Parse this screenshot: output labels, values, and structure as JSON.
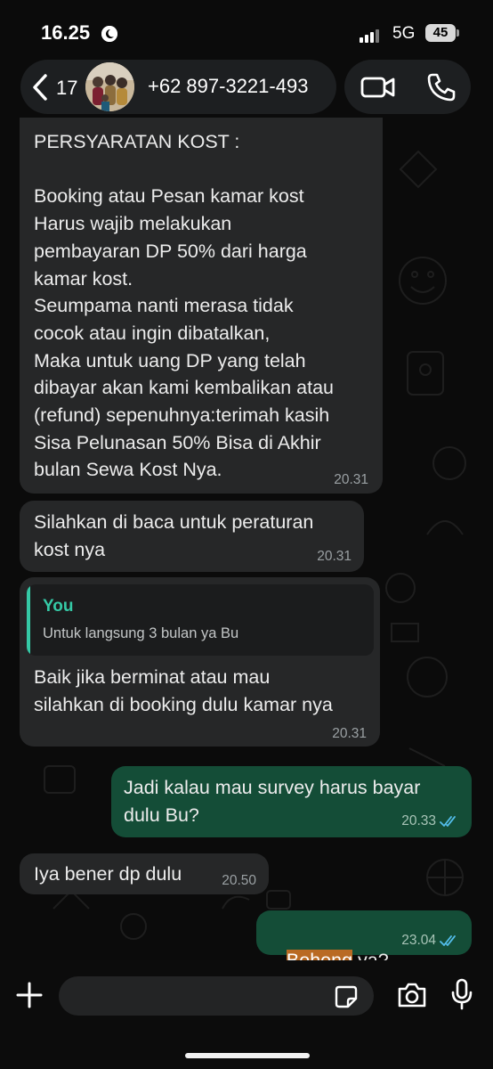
{
  "status_bar": {
    "time": "16.25",
    "network": "5G",
    "battery": "45"
  },
  "header": {
    "back_count": "17",
    "contact": "+62 897-3221-493"
  },
  "messages": [
    {
      "direction": "incoming",
      "text": "PERSYARATAN KOST :\n\nBooking atau Pesan kamar kost\nHarus wajib melakukan\npembayaran DP 50% dari harga\nkamar kost.\nSeumpama nanti merasa tidak\ncocok atau ingin dibatalkan,\nMaka untuk uang DP yang telah\ndibayar akan kami kembalikan atau\n(refund) sepenuhnya:terimah kasih\nSisa Pelunasan 50% Bisa di Akhir\nbulan Sewa Kost Nya.",
      "time": "20.31"
    },
    {
      "direction": "incoming",
      "text": "Silahkan di baca untuk peraturan\nkost nya",
      "time": "20.31"
    },
    {
      "direction": "incoming",
      "quote": {
        "author": "You",
        "text": "Untuk langsung 3 bulan ya Bu"
      },
      "text": "Baik jika berminat atau mau\nsilahkan di booking dulu kamar nya",
      "time": "20.31"
    },
    {
      "direction": "outgoing",
      "text": "Jadi kalau mau survey harus bayar\ndulu Bu?",
      "time": "20.33",
      "status": "read"
    },
    {
      "direction": "incoming",
      "text": "Iya bener dp dulu",
      "time": "20.50"
    },
    {
      "direction": "outgoing",
      "text_highlighted": "Bohong",
      "text_rest": " ya?",
      "time": "23.04",
      "status": "read"
    }
  ],
  "input": {
    "placeholder": "",
    "value": ""
  },
  "colors": {
    "incoming_bubble": "#262728",
    "outgoing_bubble": "#144d37",
    "read_ticks": "#53bdeb",
    "quote_accent": "#35c9a6",
    "highlight": "#b96a23"
  },
  "icons": [
    "moon-icon",
    "signal-icon",
    "back-chevron-icon",
    "video-call-icon",
    "phone-call-icon",
    "read-ticks-icon",
    "plus-icon",
    "sticker-icon",
    "camera-icon",
    "mic-icon"
  ]
}
